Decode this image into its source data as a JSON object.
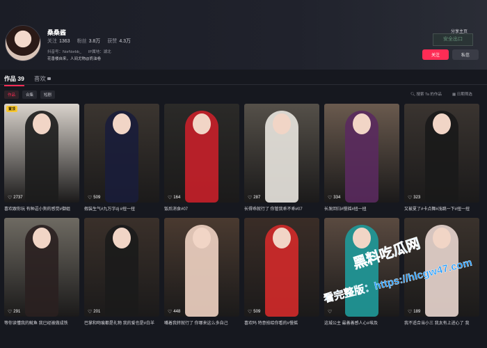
{
  "profile": {
    "name": "桑桑酱",
    "follow_label": "关注",
    "follow_count": "1363",
    "fans_label": "粉丝",
    "fans_count": "3.8万",
    "likes_label": "获赞",
    "likes_count": "4.3万",
    "douyin_id": "抖音号：NorNorbb_",
    "ip_location": "IP属地：湖北",
    "bio": "花香楼自来，人间尤物@奶油卷"
  },
  "actions": {
    "share_label": "分享主页",
    "follow_button": "关注",
    "message_button": "私信",
    "exit_sign": "安全出口"
  },
  "tabs": {
    "works_label": "作品 39",
    "likes_label": "喜欢"
  },
  "filters": {
    "chips": [
      "作品",
      "合集",
      "短剧"
    ],
    "search_label": "搜索 Ta 的作品",
    "date_filter_label": "日期筛选"
  },
  "videos": [
    {
      "likes": "2737",
      "caption": "喜欢跟你玩 有种逗小狗的感觉#御姐",
      "badge": "置顶"
    },
    {
      "likes": "509",
      "caption": "假装生气#九万字dj #扭一扭"
    },
    {
      "likes": "164",
      "caption": "饭后消食#07"
    },
    {
      "likes": "287",
      "caption": "长得乖就行了 你管我乖不乖#07"
    },
    {
      "likes": "334",
      "caption": "长发回归#慢摇#扭一扭"
    },
    {
      "likes": "323",
      "caption": "又被夏了#卡点舞#浅跳一下#扭一扭"
    },
    {
      "likes": "291",
      "caption": "等你读懂我的鱿鱼 我已经被做成铁"
    },
    {
      "likes": "201",
      "caption": "巴掌和吻痕都是礼物 我的爱也是#白羊"
    },
    {
      "likes": "448",
      "caption": "嘴着我转就行了 你哪来这么多自己"
    },
    {
      "likes": "509",
      "caption": "喜欢吗 特意拍给你看的#慢摇"
    },
    {
      "likes": "",
      "caption": "这城公主 最善善感人心#埃及"
    },
    {
      "likes": "189",
      "caption": "我不适合当小三 我太有上进心了 我"
    }
  ],
  "watermark": {
    "line1": "黑料吃瓜网",
    "line2": "看完整版：https://hlcgw47.com"
  },
  "colors": {
    "accent": "#fe2c55",
    "background": "#16181f",
    "secondary_button": "#3a3c46"
  }
}
